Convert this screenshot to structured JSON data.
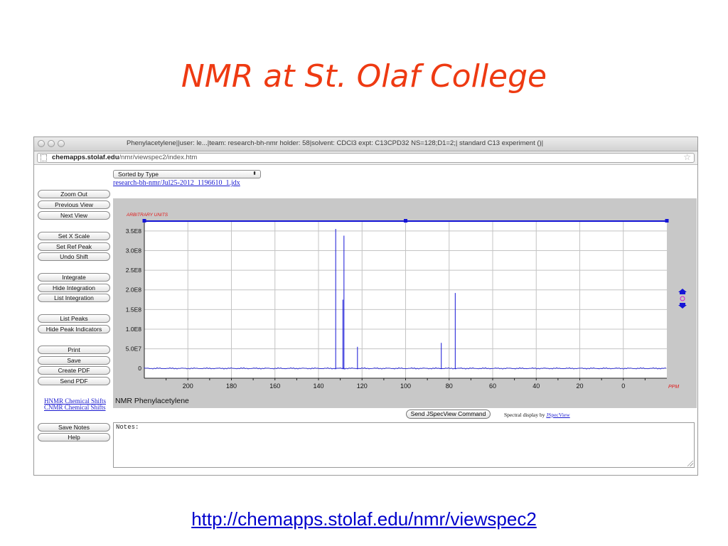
{
  "slide": {
    "title": "NMR at St. Olaf College",
    "link_url": "http://chemapps.stolaf.edu/nmr/viewspec2"
  },
  "browser": {
    "window_title": "Phenylacetylene||user: le...|team: research-bh-nmr holder: 58|solvent: CDCl3 expt: C13CPD32 NS=128;D1=2;| standard C13 experiment ()|",
    "url_host": "chemapps.stolaf.edu",
    "url_path": "/nmr/viewspec2/index.htm"
  },
  "sidebar": {
    "buttons": [
      "Zoom Out",
      "Previous View",
      "Next View",
      "Set X Scale",
      "Set Ref Peak",
      "Undo Shift",
      "Integrate",
      "Hide Integration",
      "List Integration",
      "List Peaks",
      "Hide Peak Indicators",
      "Print",
      "Save",
      "Create PDF",
      "Send PDF"
    ],
    "links": [
      "HNMR Chemical Shifts",
      "CNMR Chemical Shifts"
    ],
    "bottom_buttons": [
      "Save Notes",
      "Help"
    ]
  },
  "viewer": {
    "sort_select": "Sorted by Type",
    "sort_arrows": "⬍",
    "file_link": "research-bh-nmr/Jul25-2012_1196610_1.jdx",
    "caption": "NMR Phenylacetylene",
    "send_button": "Send JSpecView Command",
    "credit_prefix": "Spectral display by",
    "credit_link": "JSpecView",
    "notes_label": "Notes:"
  },
  "colors": {
    "title": "#ee3a12",
    "spectrum_line": "#1515d6",
    "axis_unit_labels": "#e01b1b",
    "link": "#1a1ad0",
    "plot_background": "#c8c8c8"
  },
  "chart_data": {
    "type": "line",
    "title": "",
    "xlabel": "PPM",
    "ylabel": "ARBITRARY UNITS",
    "x_reversed": true,
    "xlim": [
      220,
      -20
    ],
    "ylim": [
      -25000000.0,
      375000000.0
    ],
    "x_ticks": [
      200,
      180,
      160,
      140,
      120,
      100,
      80,
      60,
      40,
      20,
      0
    ],
    "x_tick_labels": [
      "200",
      "180",
      "160",
      "140",
      "120",
      "100",
      "80",
      "60",
      "40",
      "20",
      "0"
    ],
    "y_ticks": [
      0,
      50000000.0,
      100000000.0,
      150000000.0,
      200000000.0,
      250000000.0,
      300000000.0,
      350000000.0
    ],
    "y_tick_labels": [
      "0",
      "5.0E7",
      "1.0E8",
      "1.5E8",
      "2.0E8",
      "2.5E8",
      "3.0E8",
      "3.5E8"
    ],
    "grid": true,
    "peaks": [
      {
        "x": 132.1,
        "y": 355000000.0
      },
      {
        "x": 128.8,
        "y": 175000000.0
      },
      {
        "x": 128.3,
        "y": 338000000.0
      },
      {
        "x": 122.1,
        "y": 55000000.0
      },
      {
        "x": 83.6,
        "y": 65000000.0
      },
      {
        "x": 77.2,
        "y": 192000000.0
      }
    ]
  }
}
